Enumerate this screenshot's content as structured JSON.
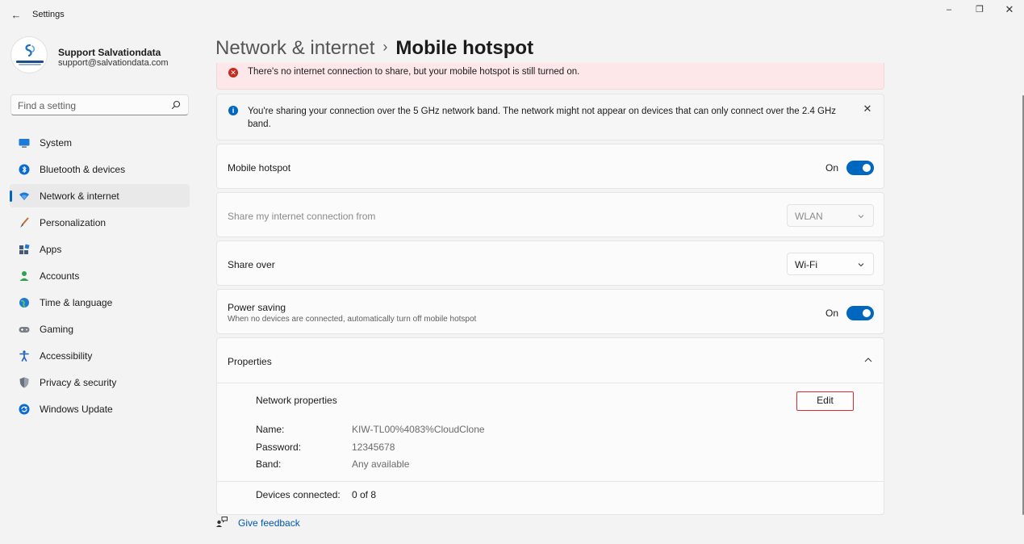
{
  "window": {
    "title": "Settings",
    "back_glyph": "←",
    "minimize_glyph": "–",
    "maximize_glyph": "❐",
    "close_glyph": "✕"
  },
  "profile": {
    "name": "Support Salvationdata",
    "email": "support@salvationdata.com"
  },
  "search": {
    "placeholder": "Find a setting"
  },
  "sidebar": {
    "items": [
      {
        "label": "System",
        "icon": "monitor-icon",
        "active": false
      },
      {
        "label": "Bluetooth & devices",
        "icon": "bluetooth-icon",
        "active": false
      },
      {
        "label": "Network & internet",
        "icon": "wifi-icon",
        "active": true
      },
      {
        "label": "Personalization",
        "icon": "brush-icon",
        "active": false
      },
      {
        "label": "Apps",
        "icon": "apps-icon",
        "active": false
      },
      {
        "label": "Accounts",
        "icon": "person-icon",
        "active": false
      },
      {
        "label": "Time & language",
        "icon": "globe-clock-icon",
        "active": false
      },
      {
        "label": "Gaming",
        "icon": "controller-icon",
        "active": false
      },
      {
        "label": "Accessibility",
        "icon": "accessibility-icon",
        "active": false
      },
      {
        "label": "Privacy & security",
        "icon": "shield-icon",
        "active": false
      },
      {
        "label": "Windows Update",
        "icon": "update-icon",
        "active": false
      }
    ]
  },
  "breadcrumb": {
    "parent": "Network & internet",
    "separator": "›",
    "current": "Mobile hotspot"
  },
  "error_banner": {
    "text": "There's no internet connection to share, but your mobile hotspot is still turned on.",
    "icon_glyph": "✕"
  },
  "info_banner": {
    "text": "You're sharing your connection over the 5 GHz network band. The network might not appear on devices that can only connect over the 2.4 GHz band.",
    "icon_glyph": "i",
    "close_glyph": "✕"
  },
  "settings": {
    "mobile_hotspot": {
      "label": "Mobile hotspot",
      "state": "On"
    },
    "share_from": {
      "label": "Share my internet connection from",
      "value": "WLAN"
    },
    "share_over": {
      "label": "Share over",
      "value": "Wi-Fi"
    },
    "power_saving": {
      "label": "Power saving",
      "description": "When no devices are connected, automatically turn off mobile hotspot",
      "state": "On"
    }
  },
  "properties": {
    "header": "Properties",
    "section_title": "Network properties",
    "edit_label": "Edit",
    "name_key": "Name:",
    "name_value": "KIW-TL00%4083%CloudClone",
    "password_key": "Password:",
    "password_value": "12345678",
    "band_key": "Band:",
    "band_value": "Any available",
    "devices_key": "Devices connected:",
    "devices_value": "0 of 8"
  },
  "footer": {
    "feedback_label": "Give feedback"
  },
  "colors": {
    "accent": "#0067c0",
    "error_bg": "#fde7e9",
    "error_icon": "#c42b1c",
    "highlight_border": "#e0282e"
  }
}
